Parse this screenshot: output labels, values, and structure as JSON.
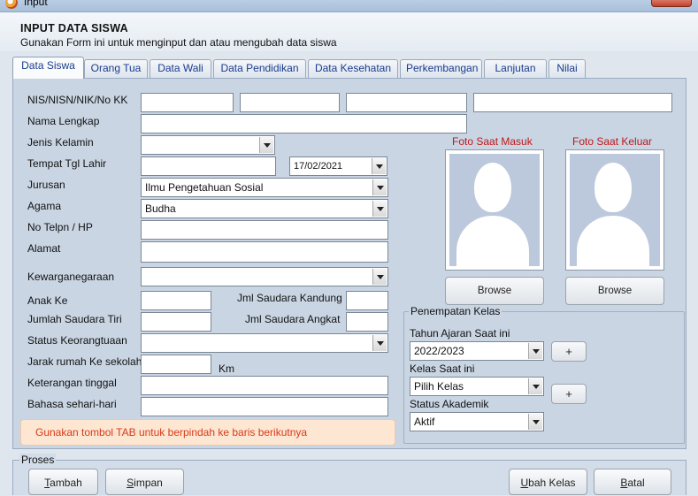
{
  "window": {
    "title": "Input"
  },
  "header": {
    "title": "INPUT DATA SISWA",
    "subtitle": "Gunakan Form ini untuk menginput dan atau mengubah data siswa"
  },
  "tabs": [
    {
      "label": "Data Siswa",
      "active": true
    },
    {
      "label": "Orang Tua"
    },
    {
      "label": "Data Wali"
    },
    {
      "label": "Data Pendidikan"
    },
    {
      "label": "Data Kesehatan"
    },
    {
      "label": "Perkembangan"
    },
    {
      "label": "Lanjutan"
    },
    {
      "label": "Nilai"
    }
  ],
  "form": {
    "nis_label": "NIS/NISN/NIK/No KK",
    "nama_label": "Nama Lengkap",
    "jk_label": "Jenis Kelamin",
    "ttl_label": "Tempat Tgl Lahir",
    "ttl_date": "17/02/2021",
    "jurusan_label": "Jurusan",
    "jurusan_value": "Ilmu Pengetahuan Sosial",
    "agama_label": "Agama",
    "agama_value": "Budha",
    "telp_label": "No Telpn / HP",
    "alamat_label": "Alamat",
    "kewarga_label": "Kewarganegaraan",
    "anak_label": "Anak Ke",
    "saudara_kandung_label": "Jml Saudara Kandung",
    "saudara_tiri_label": "Jumlah Saudara Tiri",
    "saudara_angkat_label": "Jml Saudara Angkat",
    "keortu_label": "Status Keorangtuaan",
    "jarak_label": "Jarak rumah Ke sekolah",
    "jarak_unit": "Km",
    "tinggal_label": "Keterangan tinggal",
    "bahasa_label": "Bahasa sehari-hari"
  },
  "photos": {
    "masuk_label": "Foto Saat Masuk",
    "keluar_label": "Foto Saat Keluar",
    "browse_label": "Browse"
  },
  "kelas": {
    "group_title": "Penempatan Kelas",
    "tahun_label": "Tahun Ajaran Saat ini",
    "tahun_value": "2022/2023",
    "kelas_label": "Kelas Saat ini",
    "kelas_value": "Pilih Kelas",
    "status_label": "Status Akademik",
    "status_value": "Aktif",
    "plus_label": "+"
  },
  "hint": "Gunakan tombol TAB untuk berpindah ke baris berikutnya",
  "proses": {
    "title": "Proses",
    "tambah_u": "T",
    "tambah_rest": "ambah",
    "simpan_u": "S",
    "simpan_rest": "impan",
    "ubah_u": "U",
    "ubah_rest": "bah Kelas",
    "batal_u": "B",
    "batal_rest": "atal"
  }
}
